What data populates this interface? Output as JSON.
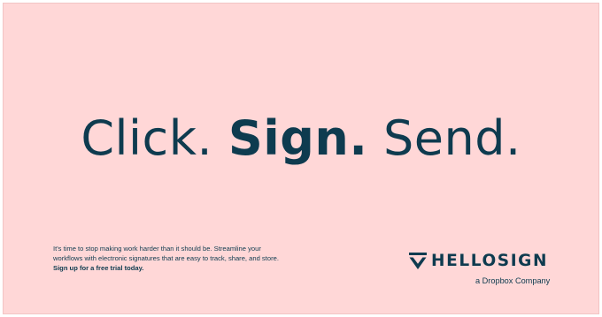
{
  "headline": {
    "word1": "Click.",
    "word2": "Sign.",
    "word3": "Send."
  },
  "copy": {
    "line1": "It's time to stop making work harder than it should be. Streamline your",
    "line2": "workflows with electronic signatures that are easy to track, share, and store.",
    "cta": "Sign up for a free trial today."
  },
  "brand": {
    "wordmark": "HELLOSIGN",
    "tagline": "a Dropbox Company",
    "logo_icon": "hellosign-check-icon"
  },
  "colors": {
    "background": "#ffd7d7",
    "ink": "#0e3b4f"
  }
}
